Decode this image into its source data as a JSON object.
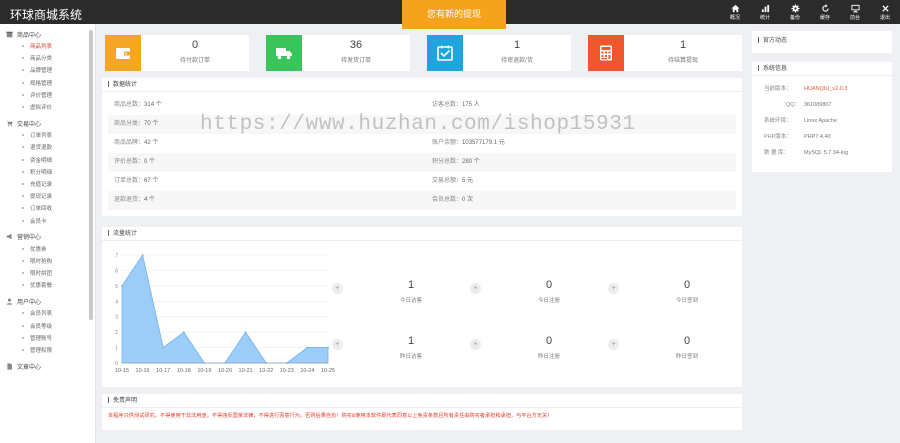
{
  "app": {
    "title": "环球商城系统"
  },
  "notice": "您有新的提现",
  "topnav": [
    {
      "label": "概况",
      "icon": "home-icon"
    },
    {
      "label": "统计",
      "icon": "bar-chart-icon"
    },
    {
      "label": "备份",
      "icon": "gear-icon"
    },
    {
      "label": "缓存",
      "icon": "refresh-icon"
    },
    {
      "label": "前台",
      "icon": "monitor-icon"
    },
    {
      "label": "退出",
      "icon": "close-icon"
    }
  ],
  "sidebar": {
    "groups": [
      {
        "title": "商品中心",
        "icon": "box-icon",
        "items": [
          "商品列表",
          "商品分类",
          "品牌管理",
          "规格管理",
          "评价管理",
          "虚拟评价"
        ],
        "active": 0
      },
      {
        "title": "交易中心",
        "icon": "cart-icon",
        "items": [
          "订单列表",
          "退货退款",
          "资金明细",
          "积分明细",
          "充值记录",
          "提现记录",
          "订单回收",
          "会员卡"
        ]
      },
      {
        "title": "营销中心",
        "icon": "megaphone-icon",
        "items": [
          "优惠券",
          "限时抢购",
          "限时拼团",
          "优惠套餐"
        ]
      },
      {
        "title": "用户中心",
        "icon": "user-icon",
        "items": [
          "会员列表",
          "会员等级",
          "管理账号",
          "管理权限"
        ]
      },
      {
        "title": "文章中心",
        "icon": "doc-icon",
        "items": []
      }
    ]
  },
  "stats": [
    {
      "value": "0",
      "label": "待付款订单",
      "color": "#f5a623",
      "icon": "wallet-icon"
    },
    {
      "value": "36",
      "label": "待发货订单",
      "color": "#3bc45b",
      "icon": "truck-icon"
    },
    {
      "value": "1",
      "label": "待审退款/货",
      "color": "#1fa4e0",
      "icon": "calendar-check-icon"
    },
    {
      "value": "1",
      "label": "待结算提现",
      "color": "#f0572c",
      "icon": "calculator-icon"
    }
  ],
  "data_stats": {
    "title": "数据统计",
    "rows": [
      [
        {
          "k": "商品总数：",
          "v": "314 个"
        },
        {
          "k": "访客总数：",
          "v": "175 人"
        }
      ],
      [
        {
          "k": "商品分类：",
          "v": "70 个"
        },
        {
          "k": "",
          "v": ""
        }
      ],
      [
        {
          "k": "商品品牌：",
          "v": "42 个"
        },
        {
          "k": "账户余额：",
          "v": "103577179.1 元"
        }
      ],
      [
        {
          "k": "评价总数：",
          "v": "0 个"
        },
        {
          "k": "积分总数：",
          "v": "280 个"
        }
      ],
      [
        {
          "k": "订单总数：",
          "v": "67 个"
        },
        {
          "k": "交易总额：",
          "v": "5 元"
        }
      ],
      [
        {
          "k": "退款退货：",
          "v": "4 个"
        },
        {
          "k": "会员总数：",
          "v": "0 次"
        }
      ]
    ]
  },
  "watermark": "https://www.huzhan.com/ishop15931",
  "flow": {
    "title": "流量统计",
    "tiles": [
      {
        "value": "1",
        "label": "今日访客"
      },
      {
        "value": "0",
        "label": "今日注册"
      },
      {
        "value": "0",
        "label": "今日签到"
      },
      {
        "value": "1",
        "label": "昨日访客"
      },
      {
        "value": "0",
        "label": "昨日注册"
      },
      {
        "value": "0",
        "label": "昨日签到"
      }
    ]
  },
  "chart_data": {
    "type": "area",
    "categories": [
      "10-15",
      "10-16",
      "10-17",
      "10-18",
      "10-19",
      "10-20",
      "10-21",
      "10-22",
      "10-23",
      "10-24",
      "10-25"
    ],
    "values": [
      5,
      7,
      1,
      2,
      0,
      0,
      2,
      0,
      0,
      1,
      1
    ],
    "yticks": [
      "0",
      "1",
      "2",
      "3",
      "4",
      "5",
      "6",
      "7"
    ],
    "ylim": [
      0,
      7
    ],
    "grid": true,
    "fill_color": "#9ccdf8",
    "line_color": "#6fb3f0"
  },
  "right": {
    "official_title": "官方动态",
    "sys_title": "系统信息",
    "sys": [
      {
        "k": "当前版本：",
        "v": "HUANQIU_v2.0.3",
        "red": true
      },
      {
        "k": "QQ：",
        "v": "361089807"
      },
      {
        "k": "系统环境：",
        "v": "Linux Apache"
      },
      {
        "k": "PHP版本：",
        "v": "PHP7.4.40"
      },
      {
        "k": "数 据 库：",
        "v": "MySQL 5.7.34-log"
      }
    ]
  },
  "disclaimer": {
    "title": "免责声明",
    "text": "本程序只供测试研究，不得使用于非法用途，不得违反国家法律，不得进行恶意行为。否则后果自负！购买&使用本软件即代表同意以上免责条款且所有责任由购买者承担和承担，与平台方无关！"
  }
}
